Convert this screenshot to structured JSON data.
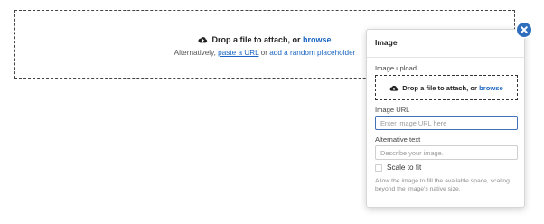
{
  "dropzone": {
    "prompt_text": "Drop a file to attach, or",
    "browse_link": "browse",
    "alt_prefix": "Alternatively,",
    "paste_url_link": "paste a URL",
    "or_text": "or",
    "placeholder_link": "add a random placeholder",
    "icon": "cloud-upload-icon"
  },
  "popover": {
    "title": "Image",
    "image_upload_label": "Image upload",
    "upload_prompt_text": "Drop a file to attach, or",
    "upload_browse_link": "browse",
    "image_url_label": "Image URL",
    "image_url_placeholder": "Enter image URL here",
    "alt_text_label": "Alternative text",
    "alt_text_placeholder": "Describe your image.",
    "scale_to_fit_label": "Scale to fit",
    "scale_to_fit_checked": false,
    "scale_help_text": "Allow the image to fill the available space, scaling beyond the image's native size."
  },
  "close_button": {
    "icon": "close-icon"
  },
  "colors": {
    "accent": "#1a66c2",
    "close_bg": "#2f6ebd"
  }
}
